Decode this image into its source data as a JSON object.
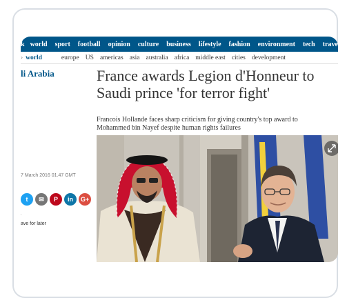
{
  "nav": {
    "items": [
      "k",
      "world",
      "sport",
      "football",
      "opinion",
      "culture",
      "business",
      "lifestyle",
      "fashion",
      "environment",
      "tech",
      "trave"
    ]
  },
  "subnav": {
    "active": "world",
    "items": [
      "europe",
      "US",
      "americas",
      "asia",
      "australia",
      "africa",
      "middle east",
      "cities",
      "development"
    ]
  },
  "section_title": "li Arabia",
  "article": {
    "headline": "France awards Legion d'Honneur to Saudi prince 'for terror fight'",
    "standfirst": "Francois Hollande faces sharp criticism for giving country's top award to Mohammed bin Nayef despite human rights failures",
    "dateline": "7 March 2016 01.47 GMT"
  },
  "share": {
    "buttons": [
      {
        "name": "twitter",
        "glyph": "t",
        "color": "#1da1f2"
      },
      {
        "name": "email",
        "glyph": "✉",
        "color": "#767676"
      },
      {
        "name": "pinterest",
        "glyph": "P",
        "color": "#bd081c"
      },
      {
        "name": "linkedin",
        "glyph": "in",
        "color": "#0e76a8"
      },
      {
        "name": "googleplus",
        "glyph": "G+",
        "color": "#dc4e41"
      }
    ]
  },
  "save_later": "ave for later",
  "photo_icon": "expand-icon",
  "colors": {
    "nav_bg": "#005689",
    "flag_blue": "#2e4fa3",
    "keffiyeh_red": "#c8102e"
  }
}
